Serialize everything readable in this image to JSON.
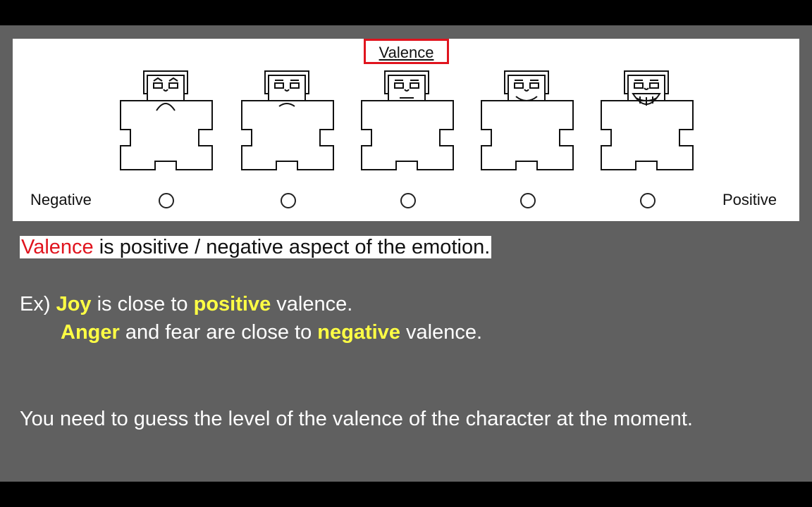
{
  "scale": {
    "title": "Valence",
    "left_label": "Negative",
    "right_label": "Positive",
    "figures": [
      {
        "mood": "very-negative"
      },
      {
        "mood": "negative"
      },
      {
        "mood": "neutral"
      },
      {
        "mood": "positive"
      },
      {
        "mood": "very-positive"
      }
    ]
  },
  "text": {
    "definition": {
      "term": "Valence",
      "rest": " is positive / negative aspect of the emotion."
    },
    "example1": {
      "prefix": "Ex) ",
      "joy": "Joy",
      "mid": " is close to ",
      "positive": "positive",
      "end": " valence."
    },
    "example2": {
      "anger": "Anger",
      "mid": " and fear are close to ",
      "negative": "negative",
      "end": " valence."
    },
    "instruction": "You need to guess the level of the valence of the character at the moment."
  },
  "colors": {
    "accent_red": "#e0141e",
    "highlight_yellow": "#ffff44",
    "background": "#606060"
  }
}
